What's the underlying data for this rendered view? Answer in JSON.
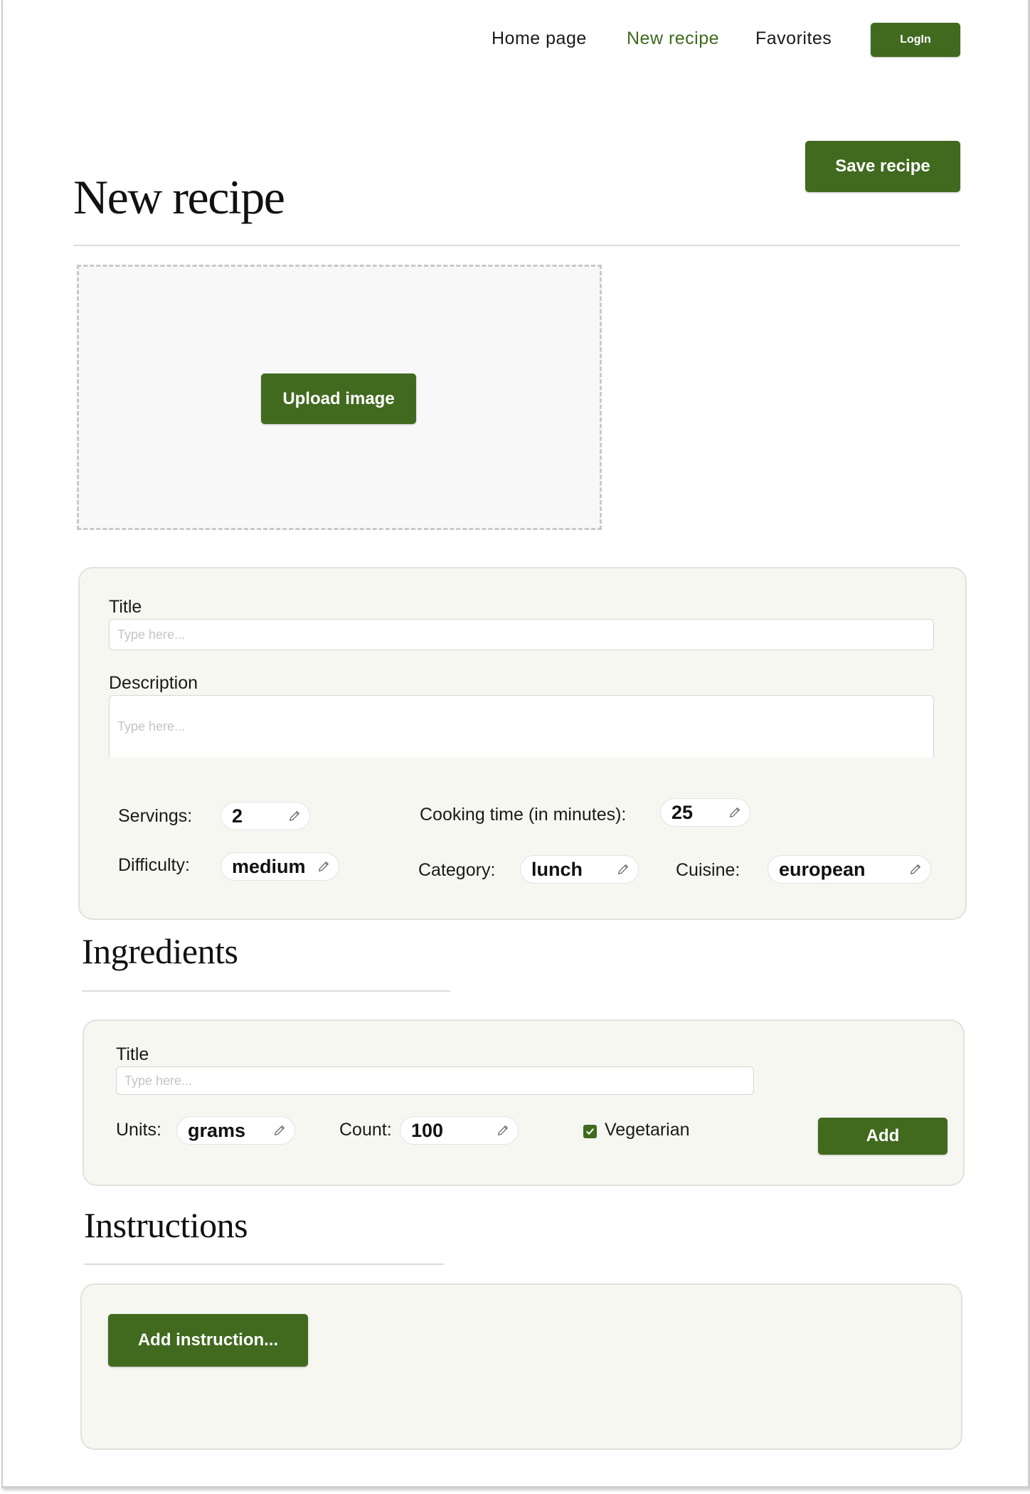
{
  "nav": {
    "links": [
      "Home page",
      "New recipe",
      "Favorites"
    ],
    "login_label": "LogIn"
  },
  "header": {
    "title": "New recipe",
    "save_label": "Save recipe"
  },
  "upload": {
    "button_label": "Upload image"
  },
  "details": {
    "title_label": "Title",
    "title_placeholder": "Type here...",
    "description_label": "Description",
    "description_placeholder": "Type here...",
    "servings_label": "Servings:",
    "servings_value": "2",
    "cooking_time_label": "Cooking time (in minutes):",
    "cooking_time_value": "25",
    "difficulty_label": "Difficulty:",
    "difficulty_value": "medium",
    "category_label": "Category:",
    "category_value": "lunch",
    "cuisine_label": "Cuisine:",
    "cuisine_value": "european"
  },
  "ingredients": {
    "heading": "Ingredients",
    "title_label": "Title",
    "title_placeholder": "Type here...",
    "units_label": "Units:",
    "units_value": "grams",
    "count_label": "Count:",
    "count_value": "100",
    "vegetarian_label": "Vegetarian",
    "vegetarian_checked": true,
    "add_label": "Add"
  },
  "instructions": {
    "heading": "Instructions",
    "add_label": "Add instruction..."
  },
  "colors": {
    "accent": "#416a1f",
    "panel_bg": "#f7f7f2"
  }
}
